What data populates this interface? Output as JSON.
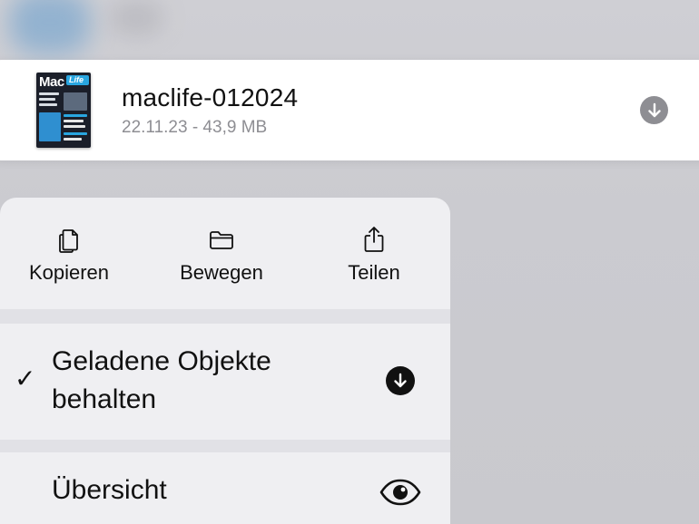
{
  "file": {
    "thumbnail_title": "Mac",
    "thumbnail_subtitle": "Life",
    "name": "maclife-012024",
    "meta": "22.11.23 - 43,9 MB",
    "download_icon": "arrow-down-circle-icon"
  },
  "menu": {
    "actions": [
      {
        "label": "Kopieren",
        "icon": "copy-icon"
      },
      {
        "label": "Bewegen",
        "icon": "folder-icon"
      },
      {
        "label": "Teilen",
        "icon": "share-icon"
      }
    ],
    "keep_downloaded": {
      "checkmark": "✓",
      "label_line1": "Geladene Objekte",
      "label_line2": "behalten",
      "icon": "arrow-down-circle-fill-icon",
      "checked": true
    },
    "overview": {
      "label": "Übersicht",
      "icon": "eye-icon"
    }
  },
  "colors": {
    "accent_gray": "#8e8e93",
    "menu_background": "#efeff2",
    "background": "#cbcbd0"
  }
}
